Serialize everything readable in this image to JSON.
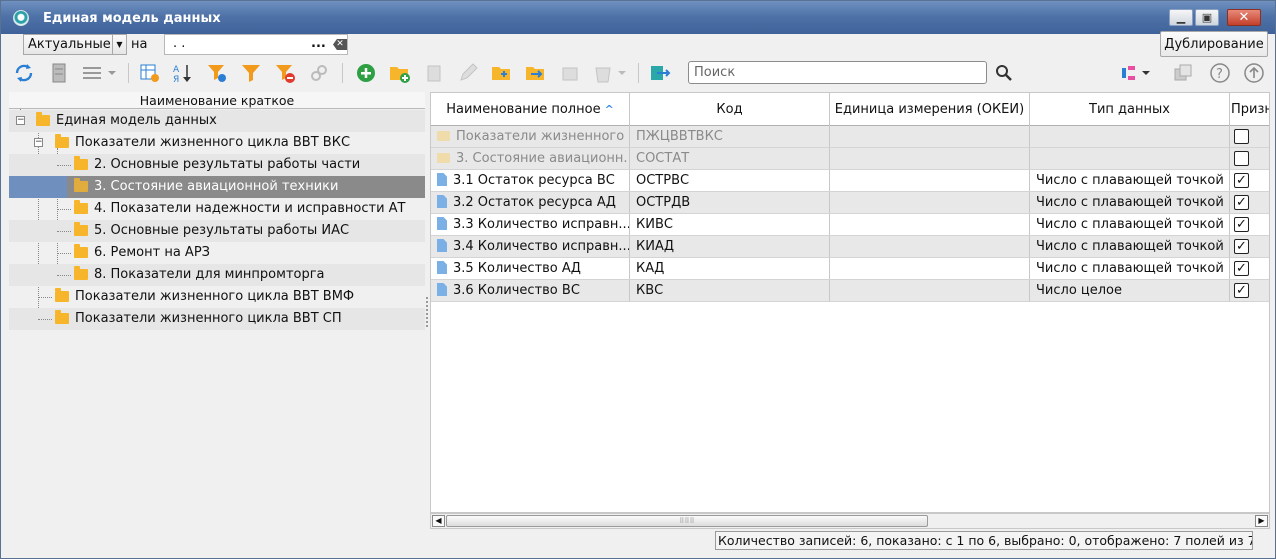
{
  "window": {
    "title": "Единая модель данных"
  },
  "filter": {
    "period_value": "Актуальные",
    "on_label": "на",
    "date_value": ". .",
    "more_label": "..."
  },
  "duplicate_button": "Дублирование",
  "search": {
    "placeholder": "Поиск"
  },
  "tree": {
    "header": "Наименование краткое",
    "items": [
      {
        "label": "Единая модель данных"
      },
      {
        "label": "Показатели жизненного цикла ВВТ ВКС"
      },
      {
        "label": "2. Основные результаты работы части"
      },
      {
        "label": "3. Состояние авиационной техники"
      },
      {
        "label": "4. Показатели надежности и исправности АТ"
      },
      {
        "label": "5. Основные результаты работы ИАС"
      },
      {
        "label": "6. Ремонт на АРЗ"
      },
      {
        "label": "8. Показатели для минпромторга"
      },
      {
        "label": "Показатели жизненного цикла ВВТ ВМФ"
      },
      {
        "label": "Показатели жизненного цикла ВВТ СП"
      }
    ]
  },
  "table": {
    "columns": [
      "Наименование полное",
      "Код",
      "Единица измерения (ОКЕИ)",
      "Тип данных",
      "Призн"
    ],
    "rows": [
      {
        "name": "Показатели жизненного ...",
        "code": "ПЖЦВВТВКС",
        "unit": "",
        "type": "",
        "checked": ""
      },
      {
        "name": "3. Состояние авиационн...",
        "code": "СОСТАТ",
        "unit": "",
        "type": "",
        "checked": ""
      },
      {
        "name": "3.1 Остаток ресурса ВС",
        "code": "ОСТРВС",
        "unit": "",
        "type": "Число с плавающей точкой",
        "checked": "✓"
      },
      {
        "name": "3.2 Остаток ресурса АД",
        "code": "ОСТРДВ",
        "unit": "",
        "type": "Число с плавающей точкой",
        "checked": "✓"
      },
      {
        "name": "3.3 Количество исправн...",
        "code": "КИВС",
        "unit": "",
        "type": "Число с плавающей точкой",
        "checked": "✓"
      },
      {
        "name": "3.4 Количество исправн...",
        "code": "КИАД",
        "unit": "",
        "type": "Число с плавающей точкой",
        "checked": "✓"
      },
      {
        "name": "3.5 Количество АД",
        "code": "КАД",
        "unit": "",
        "type": "Число с плавающей точкой",
        "checked": "✓"
      },
      {
        "name": "3.6 Количество ВС",
        "code": "КВС",
        "unit": "",
        "type": "Число целое",
        "checked": "✓"
      }
    ]
  },
  "status": "Количество записей: 6, показано: с 1 по 6, выбрано: 0, отображено: 7 полей из 7",
  "colors": {
    "title_bar": "#4f73a8",
    "selection": "#8a8a8a",
    "selection_accent": "#6f8fbf",
    "add_green": "#2ea043",
    "filter_orange": "#f29a1c"
  }
}
